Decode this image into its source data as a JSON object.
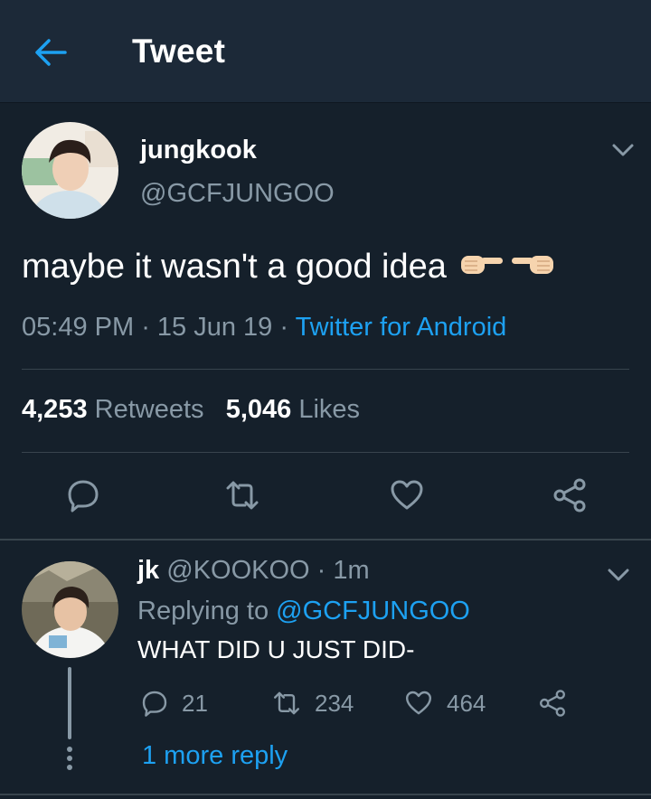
{
  "header": {
    "title": "Tweet",
    "back_icon": "arrow-left-icon",
    "accent": "#1da1f2"
  },
  "tweet": {
    "author_name": "jungkook",
    "author_handle": "@GCFJUNGOO",
    "text": "maybe it wasn't a good idea",
    "emoji": [
      "finger-pointing-right-icon",
      "finger-pointing-left-icon"
    ],
    "time": "05:49 PM",
    "date": "15 Jun 19",
    "source": "Twitter for Android",
    "retweets_count": "4,253",
    "retweets_label": "Retweets",
    "likes_count": "5,046",
    "likes_label": "Likes",
    "actions": [
      "reply-icon",
      "retweet-icon",
      "like-icon",
      "share-icon"
    ]
  },
  "reply": {
    "author_name": "jk",
    "author_handle": "@KOOKOO",
    "time": "1m",
    "replying_label": "Replying to",
    "replying_to": "@GCFJUNGOO",
    "text": "WHAT DID U JUST DID-",
    "reply_count": "21",
    "retweet_count": "234",
    "like_count": "464",
    "more_replies": "1 more reply"
  },
  "colors": {
    "background": "#15202b",
    "header": "#1c2938",
    "muted": "#8899a6",
    "link": "#1da1f2",
    "divider": "#38444d"
  }
}
